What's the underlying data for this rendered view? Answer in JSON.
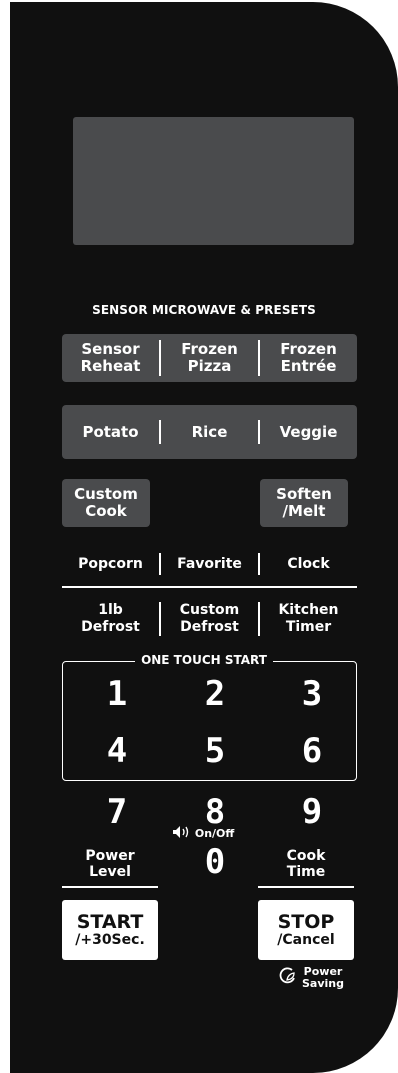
{
  "display": {
    "text": ""
  },
  "section_title": "SENSOR MICROWAVE & PRESETS",
  "sensor_row": [
    {
      "l1": "Sensor",
      "l2": "Reheat"
    },
    {
      "l1": "Frozen",
      "l2": "Pizza"
    },
    {
      "l1": "Frozen",
      "l2": "Entrée"
    }
  ],
  "food_row": [
    "Potato",
    "Rice",
    "Veggie"
  ],
  "custom_cook": {
    "l1": "Custom",
    "l2": "Cook"
  },
  "soften_melt": {
    "l1": "Soften",
    "l2": "/Melt"
  },
  "quick_row": [
    "Popcorn",
    "Favorite",
    "Clock"
  ],
  "defrost_row": [
    {
      "l1": "1lb",
      "l2": "Defrost"
    },
    {
      "l1": "Custom",
      "l2": "Defrost"
    },
    {
      "l1": "Kitchen",
      "l2": "Timer"
    }
  ],
  "one_touch_title": "ONE TOUCH START",
  "digits": [
    "1",
    "2",
    "3",
    "4",
    "5",
    "6",
    "7",
    "8",
    "9",
    "0"
  ],
  "sound_label": "On/Off",
  "power_level": {
    "l1": "Power",
    "l2": "Level"
  },
  "cook_time": {
    "l1": "Cook",
    "l2": "Time"
  },
  "start": {
    "big": "START",
    "small": "/+30Sec."
  },
  "stop": {
    "big": "STOP",
    "small": "/Cancel"
  },
  "power_saving": {
    "l1": "Power",
    "l2": "Saving"
  }
}
